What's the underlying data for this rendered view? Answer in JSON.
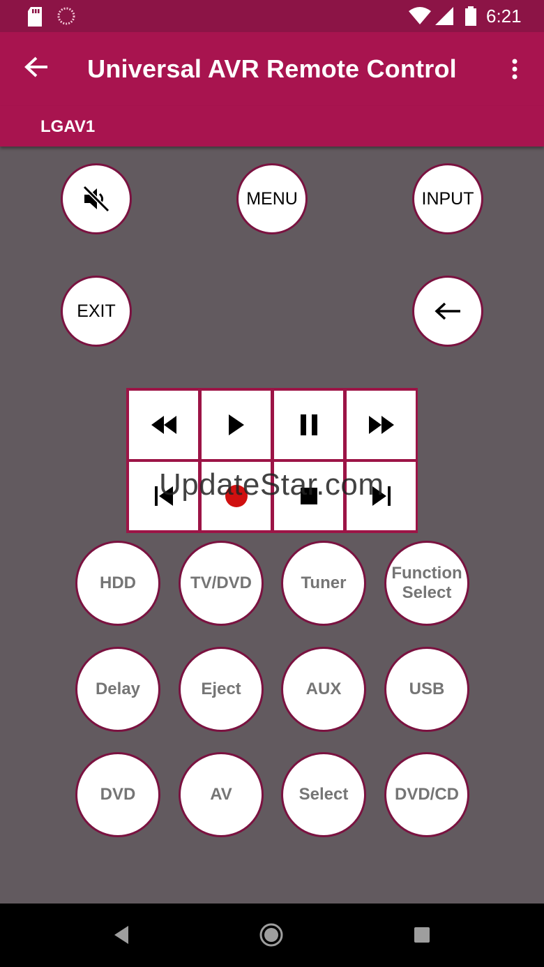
{
  "status_bar": {
    "time": "6:21"
  },
  "app_bar": {
    "title": "Universal AVR Remote Control"
  },
  "device": {
    "name": "LGAV1"
  },
  "top_buttons": {
    "mute_icon": "mute-icon",
    "menu": "MENU",
    "input": "INPUT",
    "exit": "EXIT",
    "back_icon": "arrow-left-icon"
  },
  "media_controls": {
    "row1": [
      "rewind",
      "play",
      "pause",
      "fast-forward"
    ],
    "row2": [
      "previous",
      "record",
      "stop",
      "next"
    ],
    "record_color": "#d01010"
  },
  "watermark": "UpdateStar.com",
  "function_buttons": [
    {
      "label": "HDD"
    },
    {
      "label": "TV/DVD"
    },
    {
      "label": "Tuner"
    },
    {
      "label": "FunctionSelect"
    },
    {
      "label": "Delay"
    },
    {
      "label": "Eject"
    },
    {
      "label": "AUX"
    },
    {
      "label": "USB"
    },
    {
      "label": "DVD"
    },
    {
      "label": "AV"
    },
    {
      "label": "Select"
    },
    {
      "label": "DVD/CD"
    }
  ],
  "colors": {
    "status_bar": "#8c1446",
    "app_bar": "#a8144f",
    "background": "#625a5f",
    "button_border": "#7a1240"
  }
}
